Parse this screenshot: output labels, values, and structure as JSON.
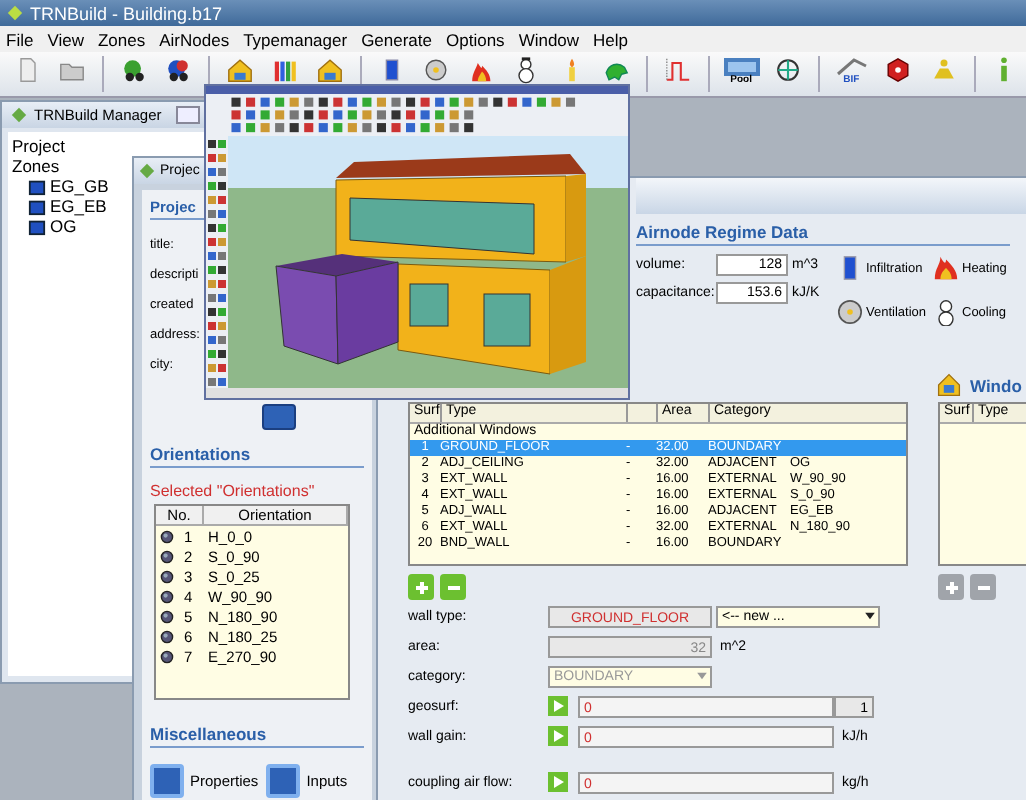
{
  "app_title": "TRNBuild - Building.b17",
  "menu": [
    "File",
    "View",
    "Zones",
    "AirNodes",
    "Typemanager",
    "Generate",
    "Options",
    "Window",
    "Help"
  ],
  "toolbar_labels": [
    "Pool",
    "BIF"
  ],
  "manager": {
    "title": "TRNBuild Manager",
    "tree": [
      {
        "label": "Project"
      },
      {
        "label": "Zones",
        "children": [
          {
            "label": "EG_GB"
          },
          {
            "label": "EG_EB"
          },
          {
            "label": "OG"
          }
        ]
      }
    ]
  },
  "project": {
    "title": "Projec",
    "heading": "Projec",
    "fields": [
      "title:",
      "descripti",
      "created",
      "address:",
      "city:"
    ],
    "orientations": {
      "heading": "Orientations",
      "selected_label": "Selected \"Orientations\"",
      "columns": [
        "No.",
        "Orientation"
      ],
      "rows": [
        {
          "no": "1",
          "name": "H_0_0"
        },
        {
          "no": "2",
          "name": "S_0_90"
        },
        {
          "no": "3",
          "name": "S_0_25"
        },
        {
          "no": "4",
          "name": "W_90_90"
        },
        {
          "no": "5",
          "name": "N_180_90"
        },
        {
          "no": "6",
          "name": "N_180_25"
        },
        {
          "no": "7",
          "name": "E_270_90"
        }
      ]
    },
    "misc": {
      "heading": "Miscellaneous",
      "buttons": [
        "Properties",
        "Inputs"
      ]
    }
  },
  "zone": {
    "airnode": {
      "heading": "Airnode Regime Data",
      "fields": [
        {
          "label": "volume:",
          "value": "128",
          "unit": "m^3"
        },
        {
          "label": "capacitance:",
          "value": "153.6",
          "unit": "kJ/K"
        }
      ],
      "regimes": [
        "Infiltration",
        "Heating",
        "Ventilation",
        "Cooling"
      ]
    },
    "windows_heading": "Windo",
    "walls": {
      "columns": [
        "Surf",
        "Type",
        "Area",
        "Category"
      ],
      "group": "Additional Windows",
      "rows": [
        {
          "surf": "1",
          "type": "GROUND_FLOOR",
          "column_3": "-",
          "area": "32.00",
          "category": "BOUNDARY",
          "selected": true
        },
        {
          "surf": "2",
          "type": "ADJ_CEILING",
          "column_3": "-",
          "area": "32.00",
          "category": "ADJACENT",
          "column_6": "OG",
          "selected": false
        },
        {
          "surf": "3",
          "type": "EXT_WALL",
          "column_3": "-",
          "area": "16.00",
          "category": "EXTERNAL",
          "column_6": "W_90_90",
          "selected": false
        },
        {
          "surf": "4",
          "type": "EXT_WALL",
          "column_3": "-",
          "area": "16.00",
          "category": "EXTERNAL",
          "column_6": "S_0_90",
          "selected": false
        },
        {
          "surf": "5",
          "type": "ADJ_WALL",
          "column_3": "-",
          "area": "16.00",
          "category": "ADJACENT",
          "column_6": "EG_EB",
          "selected": false
        },
        {
          "surf": "6",
          "type": "EXT_WALL",
          "column_3": "-",
          "area": "32.00",
          "category": "EXTERNAL",
          "column_6": "N_180_90",
          "selected": false
        },
        {
          "surf": "20",
          "type": "BND_WALL",
          "column_3": "-",
          "area": "16.00",
          "category": "BOUNDARY",
          "selected": false
        }
      ]
    },
    "windows": {
      "columns": [
        "Surf",
        "Type"
      ],
      "buttons_disabled": true
    },
    "form": [
      {
        "kind": "type",
        "label": "wall type:",
        "value": "GROUND_FLOOR",
        "choice": "<-- new ..."
      },
      {
        "kind": "number",
        "label": "area:",
        "value": "32",
        "unit": "m^2"
      },
      {
        "kind": "select",
        "label": "category:",
        "value": "BOUNDARY",
        "disabled": true
      },
      {
        "kind": "play",
        "label": "geosurf:",
        "value": "0",
        "extra": "1"
      },
      {
        "kind": "play",
        "label": "wall gain:",
        "value": "0",
        "unit": "kJ/h"
      },
      {
        "kind": "play",
        "label": "coupling air flow:",
        "value": "0",
        "unit": "kg/h"
      }
    ]
  }
}
